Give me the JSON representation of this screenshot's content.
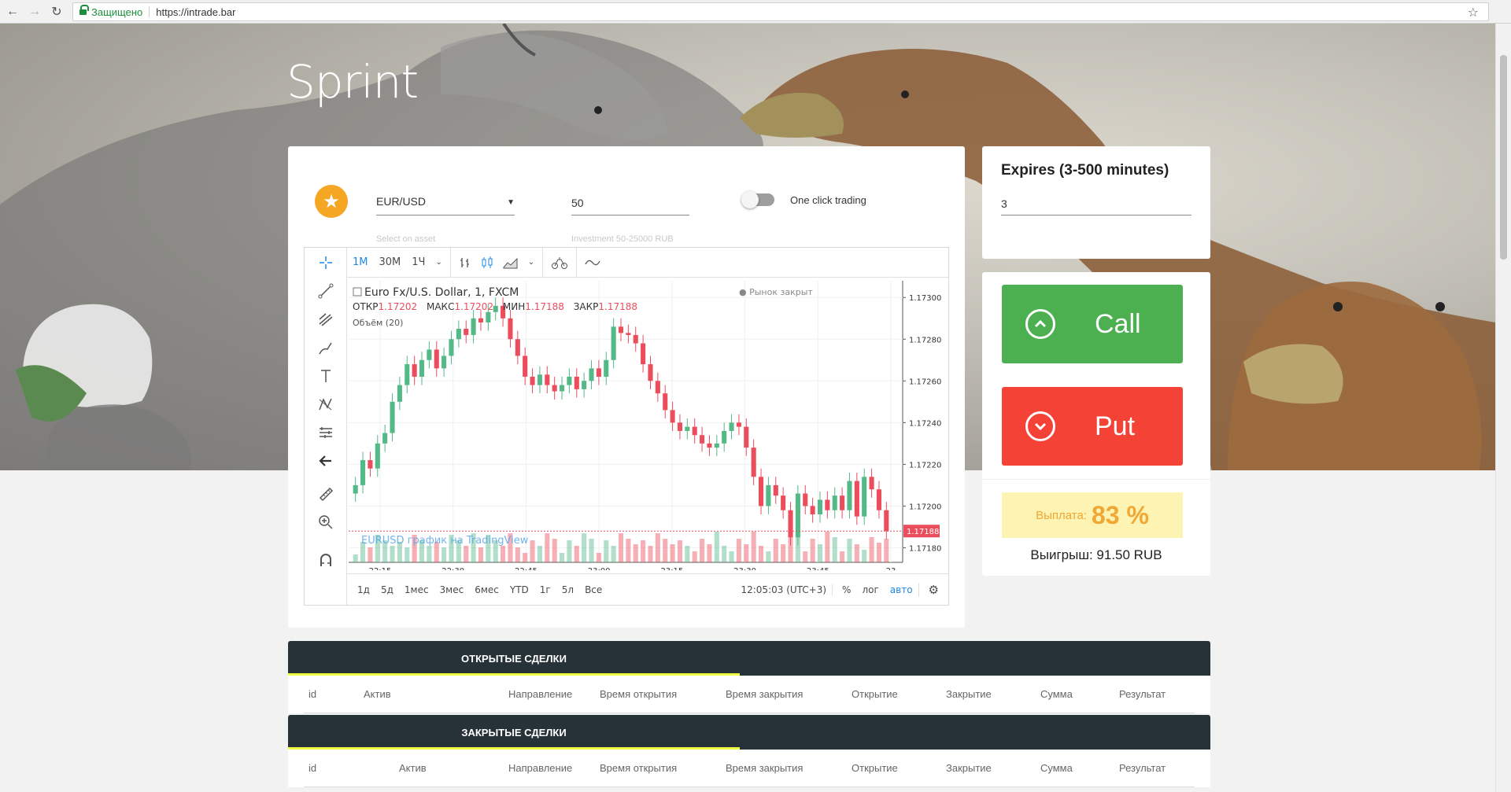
{
  "browser": {
    "secure_label": "Защищено",
    "url": "https://intrade.bar"
  },
  "page": {
    "title": "Sprint"
  },
  "trade": {
    "asset": "EUR/USD",
    "asset_hint": "Select on asset",
    "investment": "50",
    "investment_hint": "Investment 50-25000 RUB",
    "one_click_label": "One click trading",
    "one_click_enabled": false
  },
  "chart_widget": {
    "timeframes": [
      "1M",
      "30M",
      "1Ч"
    ],
    "active_timeframe": "1M",
    "ranges": [
      "1д",
      "5д",
      "1мес",
      "3мес",
      "6мес",
      "YTD",
      "1г",
      "5л",
      "Все"
    ],
    "clock": "12:05:03 (UTC+3)",
    "percent_label": "%",
    "log_label": "лог",
    "auto_label": "авто"
  },
  "chart_data": {
    "type": "candlestick",
    "title": "Euro Fx/U.S. Dollar, 1, FXCM",
    "market_status": "Рынок закрыт",
    "ohlc": {
      "open_label": "ОТКР",
      "open": "1.17202",
      "high_label": "МАКС",
      "high": "1.17202",
      "low_label": "МИН",
      "low": "1.17188",
      "close_label": "ЗАКР",
      "close": "1.17188"
    },
    "volume_label": "Объём (20)",
    "watermark": "EURUSD график на TradingView",
    "y_ticks": [
      1.173,
      1.1728,
      1.1726,
      1.1724,
      1.1722,
      1.172,
      1.1718
    ],
    "y_tick_labels": [
      "1.17300",
      "1.17280",
      "1.17260",
      "1.17240",
      "1.17220",
      "1.17200",
      "1.17180"
    ],
    "ylim": [
      1.17173,
      1.17308
    ],
    "x_tick_labels": [
      "22:15",
      "22:30",
      "22:45",
      "23:00",
      "23:15",
      "23:30",
      "23:45",
      "23"
    ],
    "last_price_label": "1.17188",
    "last_price": 1.17188,
    "closes": [
      1.1721,
      1.17222,
      1.17218,
      1.1723,
      1.17235,
      1.1725,
      1.17258,
      1.17268,
      1.17262,
      1.1727,
      1.17275,
      1.17266,
      1.17272,
      1.1728,
      1.17285,
      1.17282,
      1.1729,
      1.17288,
      1.17293,
      1.17296,
      1.1729,
      1.1728,
      1.17272,
      1.17262,
      1.17258,
      1.17263,
      1.17258,
      1.17255,
      1.17258,
      1.17262,
      1.17256,
      1.1726,
      1.17266,
      1.17262,
      1.1727,
      1.17286,
      1.17283,
      1.17282,
      1.17278,
      1.17268,
      1.1726,
      1.17254,
      1.17246,
      1.1724,
      1.17236,
      1.17238,
      1.17234,
      1.1723,
      1.17228,
      1.1723,
      1.17236,
      1.1724,
      1.17238,
      1.17228,
      1.17214,
      1.172,
      1.1721,
      1.17205,
      1.17198,
      1.17185,
      1.17206,
      1.172,
      1.17196,
      1.17203,
      1.17198,
      1.17205,
      1.17198,
      1.17212,
      1.17195,
      1.17214,
      1.17208,
      1.17198,
      1.17188
    ]
  },
  "expires": {
    "title": "Expires (3-500 minutes)",
    "value": "3"
  },
  "actions": {
    "call_label": "Call",
    "put_label": "Put",
    "payout_label": "Выплата:",
    "payout_value": "83 %",
    "win_text": "Выигрыш: 91.50 RUB"
  },
  "open_trades": {
    "tab_label": "ОТКРЫТЫЕ СДЕЛКИ",
    "columns": [
      "id",
      "Актив",
      "Направление",
      "Время открытия",
      "Время закрытия",
      "Открытие",
      "Закрытие",
      "Сумма",
      "Результат"
    ]
  },
  "closed_trades": {
    "tab_label": "ЗАКРЫТЫЕ СДЕЛКИ",
    "columns": [
      "id",
      "Актив",
      "Направление",
      "Время открытия",
      "Время закрытия",
      "Открытие",
      "Закрытие",
      "Сумма",
      "Результат"
    ]
  },
  "colors": {
    "up": "#53b987",
    "down": "#eb4d5c",
    "call": "#4caf50",
    "put": "#f44336",
    "payout": "#f0a733",
    "accent": "#1e88e5"
  },
  "icons": [
    "star-icon",
    "chevron-up-circle-icon",
    "chevron-down-circle-icon",
    "crosshair-icon",
    "trend-line-icon",
    "pitchfork-icon",
    "brush-icon",
    "text-icon",
    "pattern-icon",
    "measure-icon",
    "arrow-left-icon",
    "ruler-icon",
    "zoom-in-icon",
    "magnet-icon",
    "settings-icon"
  ]
}
